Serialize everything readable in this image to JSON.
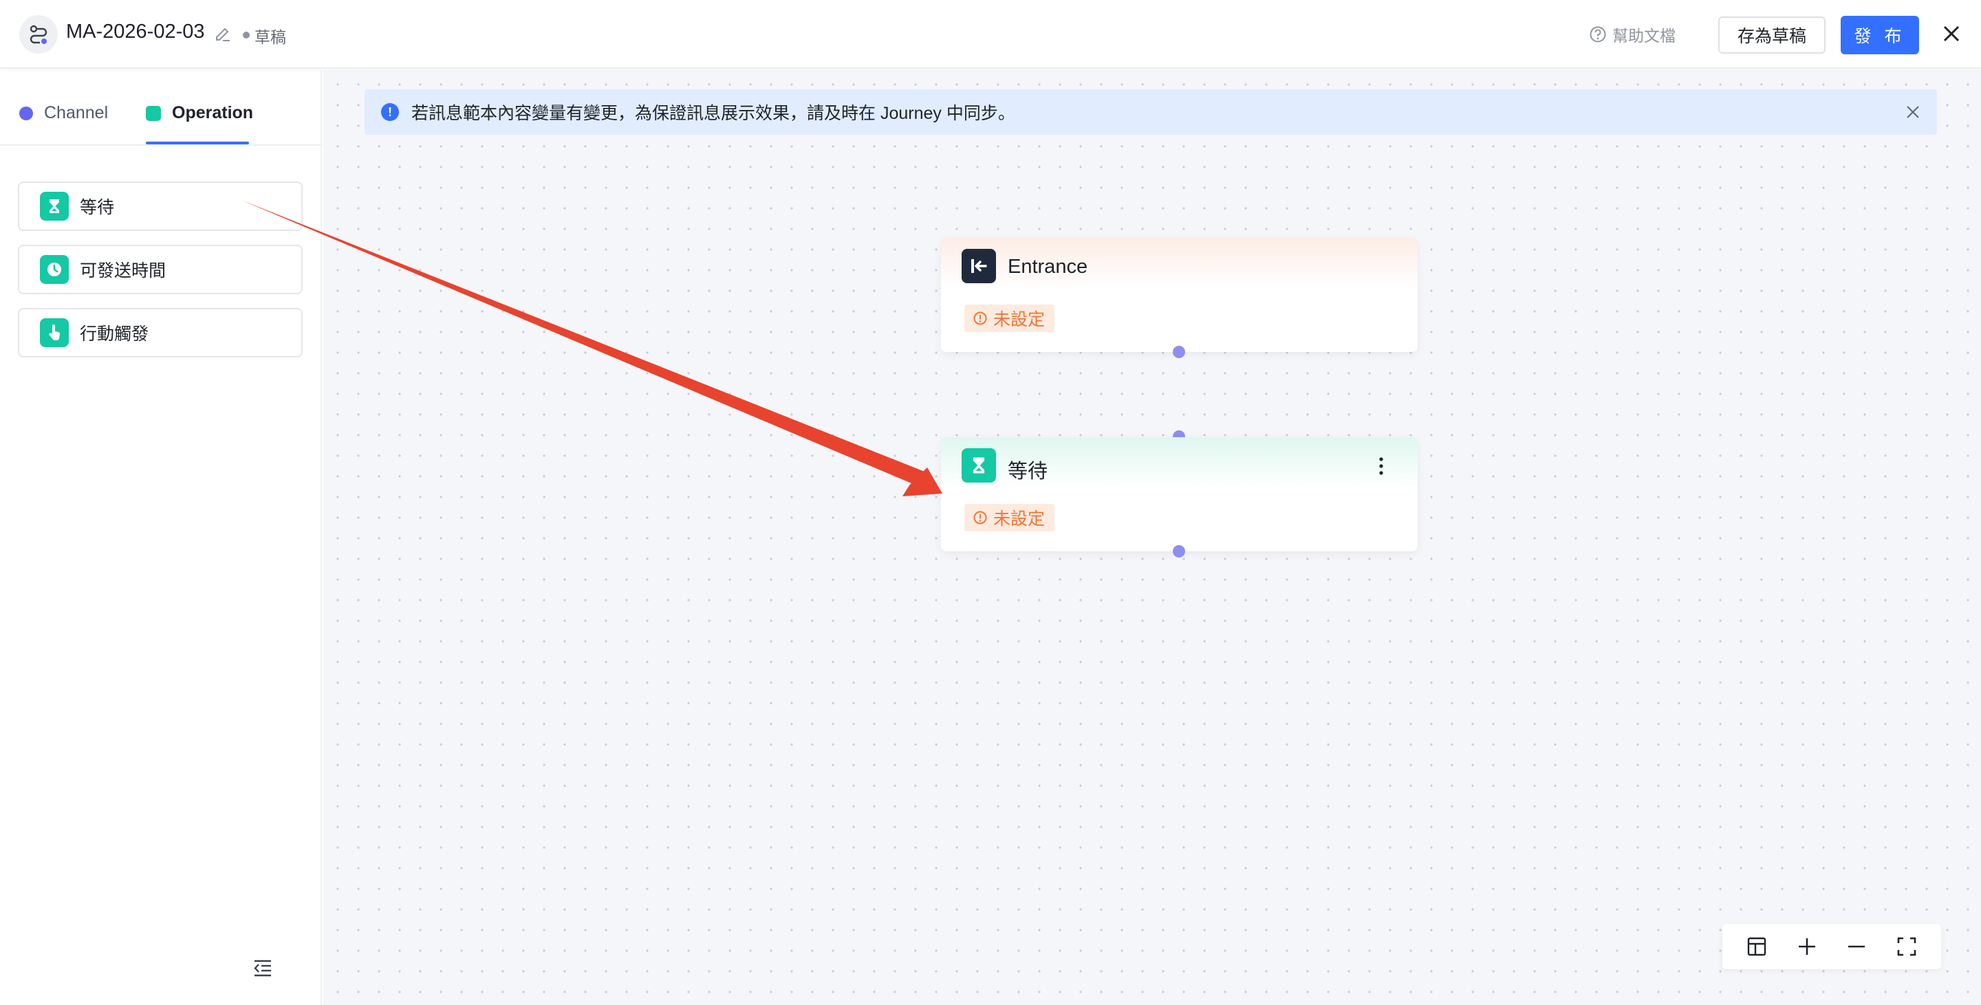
{
  "header": {
    "title": "MA-2026-02-03",
    "status": "草稿",
    "help_label": "幫助文檔",
    "save_draft_label": "存為草稿",
    "publish_label": "發 布"
  },
  "sidebar": {
    "tabs": [
      {
        "label": "Channel",
        "active": false
      },
      {
        "label": "Operation",
        "active": true
      }
    ],
    "items": [
      {
        "label": "等待",
        "icon": "hourglass-icon"
      },
      {
        "label": "可發送時間",
        "icon": "clock-icon"
      },
      {
        "label": "行動觸發",
        "icon": "pointer-hand-icon"
      }
    ]
  },
  "notice": {
    "text": "若訊息範本內容變量有變更，為保證訊息展示效果，請及時在 Journey 中同步。"
  },
  "nodes": [
    {
      "title": "Entrance",
      "status": "未設定",
      "icon": "entrance-icon"
    },
    {
      "title": "等待",
      "status": "未設定",
      "icon": "hourglass-icon"
    }
  ],
  "colors": {
    "primary": "#3370ff",
    "operation": "#14c9a4",
    "channel": "#6366f1",
    "warning": "#f77234",
    "annotation_arrow": "#e8432e"
  }
}
